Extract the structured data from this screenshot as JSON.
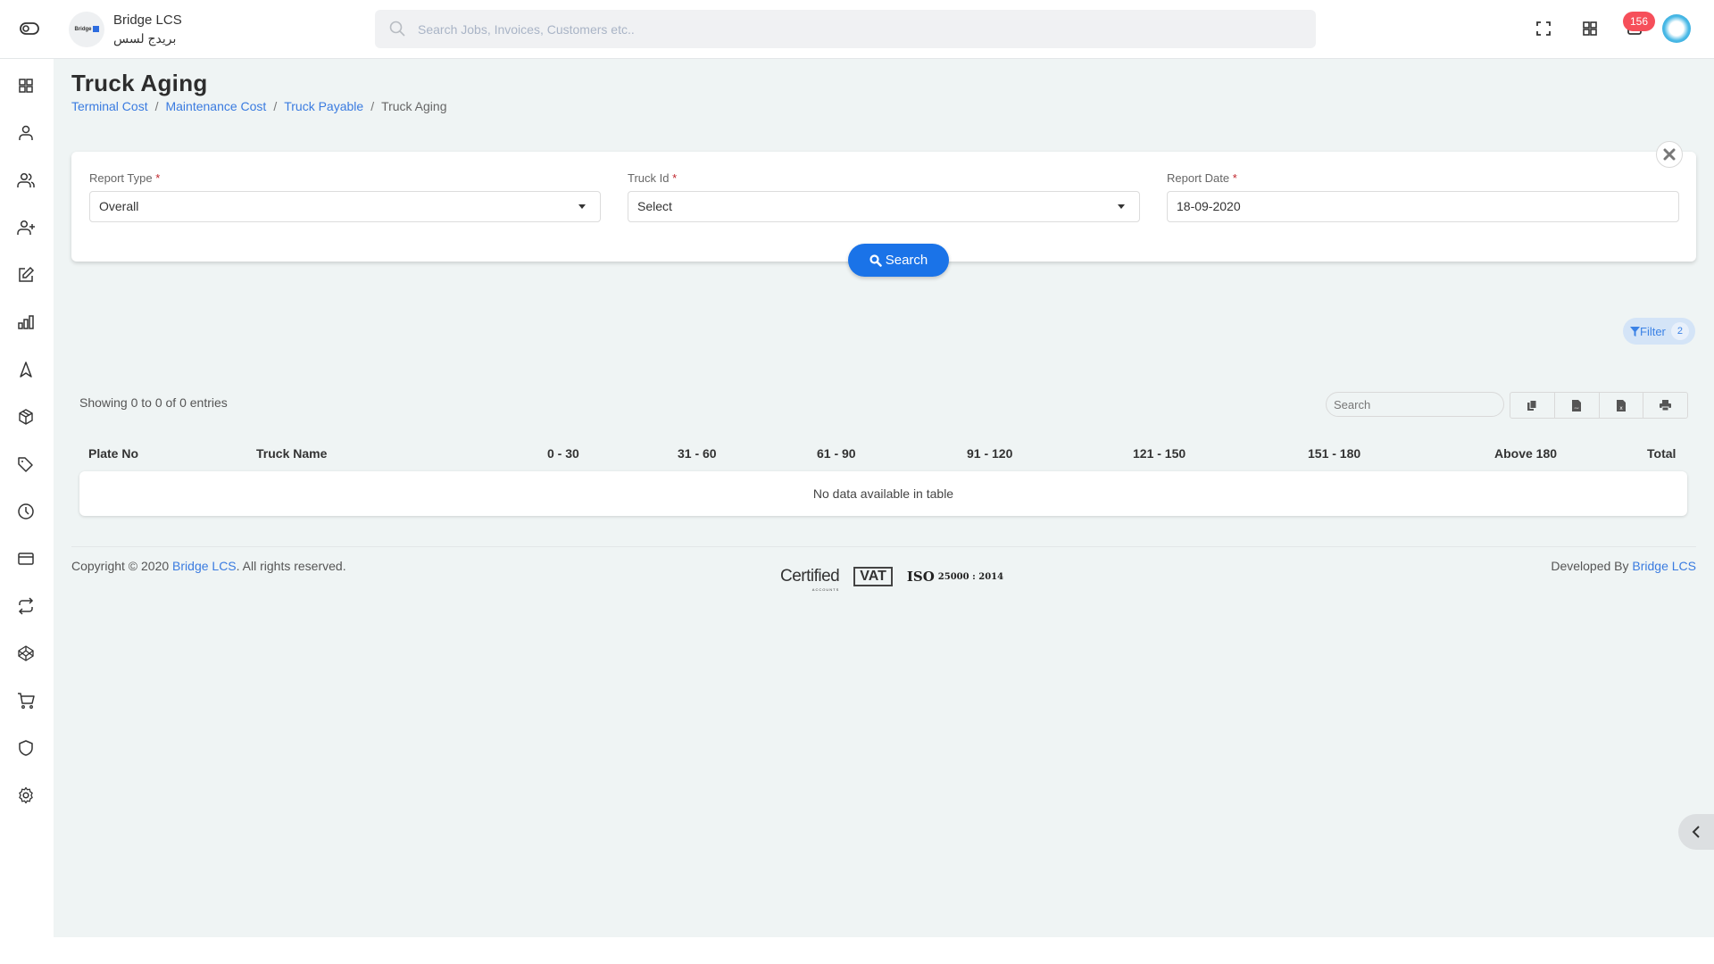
{
  "header": {
    "brand_name": "Bridge LCS",
    "brand_subtitle": "بريدج لسس",
    "logo_text": "Bridge",
    "search_placeholder": "Search Jobs, Invoices, Customers etc..",
    "notification_count": "156"
  },
  "sidebar": {
    "items": [
      {
        "icon": "dashboard-grid-icon"
      },
      {
        "icon": "user-icon"
      },
      {
        "icon": "users-icon"
      },
      {
        "icon": "user-plus-icon"
      },
      {
        "icon": "edit-icon"
      },
      {
        "icon": "bar-chart-icon"
      },
      {
        "icon": "navigation-icon"
      },
      {
        "icon": "box-icon"
      },
      {
        "icon": "tag-icon"
      },
      {
        "icon": "clock-icon"
      },
      {
        "icon": "credit-card-icon"
      },
      {
        "icon": "repeat-icon"
      },
      {
        "icon": "codepen-icon"
      },
      {
        "icon": "shopping-cart-icon"
      },
      {
        "icon": "shield-icon"
      },
      {
        "icon": "settings-icon"
      }
    ]
  },
  "page": {
    "title": "Truck Aging",
    "breadcrumb": [
      {
        "label": "Terminal Cost",
        "link": true
      },
      {
        "label": "Maintenance Cost",
        "link": true
      },
      {
        "label": "Truck Payable",
        "link": true
      },
      {
        "label": "Truck Aging",
        "link": false
      }
    ]
  },
  "filters": {
    "report_type": {
      "label": "Report Type",
      "required_mark": "*",
      "value": "Overall"
    },
    "truck_id": {
      "label": "Truck Id",
      "required_mark": "*",
      "value": "Select"
    },
    "report_date": {
      "label": "Report Date",
      "required_mark": "*",
      "value": "18-09-2020"
    },
    "search_button": "Search",
    "filter_label": "Filter",
    "filter_count": "2"
  },
  "table": {
    "info": "Showing 0 to 0 of 0 entries",
    "search_placeholder": "Search",
    "export_buttons": [
      "copy",
      "csv",
      "excel",
      "print"
    ],
    "columns": [
      "Plate No",
      "Truck Name",
      "0 - 30",
      "31 - 60",
      "61 - 90",
      "91 - 120",
      "121 - 150",
      "151 - 180",
      "Above 180",
      "Total"
    ],
    "rows": [],
    "empty_message": "No data available in table"
  },
  "footer": {
    "copyright_prefix": "Copyright © 2020 ",
    "copyright_link": "Bridge LCS",
    "copyright_suffix": ". All rights reserved.",
    "developed_by": "Developed By ",
    "developed_link": "Bridge LCS",
    "cert_certified": "Certified",
    "cert_certified_sub": "ACCOUNTS",
    "cert_vat": "VAT",
    "cert_iso": "ISO",
    "cert_iso_num": "25000 : 2014"
  },
  "colors": {
    "accent": "#1a73e8",
    "link": "#3a7be0",
    "badge": "#f64f5a",
    "page_bg": "#eff4f4"
  }
}
